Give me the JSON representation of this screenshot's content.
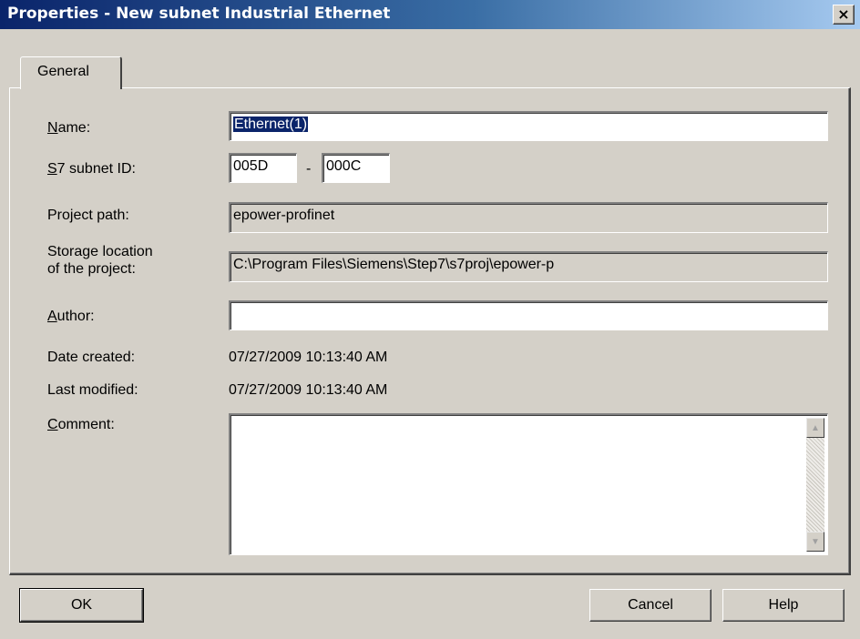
{
  "window": {
    "title": "Properties -  New subnet Industrial Ethernet",
    "close_glyph": "×"
  },
  "tabs": [
    {
      "label": "General",
      "active": true
    }
  ],
  "form": {
    "name": {
      "label_ul": "N",
      "label_rest": "ame:",
      "value": "Ethernet(1)"
    },
    "subnet_id": {
      "label_ul": "S",
      "label_rest": "7 subnet ID:",
      "value1": "005D",
      "separator": "-",
      "value2": "000C"
    },
    "project_path": {
      "label": "Project path:",
      "value": "epower-profinet"
    },
    "storage": {
      "label_line1": "Storage location",
      "label_line2": "of the project:",
      "value": "C:\\Program Files\\Siemens\\Step7\\s7proj\\epower-p"
    },
    "author": {
      "label_ul": "A",
      "label_rest": "uthor:",
      "value": ""
    },
    "date_created": {
      "label": "Date created:",
      "value": "07/27/2009 10:13:40 AM"
    },
    "last_modified": {
      "label": "Last modified:",
      "value": "07/27/2009 10:13:40 AM"
    },
    "comment": {
      "label_ul": "C",
      "label_rest": "omment:",
      "value": ""
    }
  },
  "icons": {
    "scroll_up": "▲",
    "scroll_down": "▼"
  },
  "buttons": {
    "ok": "OK",
    "cancel": "Cancel",
    "help": "Help"
  },
  "colors": {
    "title_gradient_start": "#0a246a",
    "title_gradient_end": "#a6caf0",
    "face": "#d4d0c8",
    "selection": "#0a246a"
  }
}
